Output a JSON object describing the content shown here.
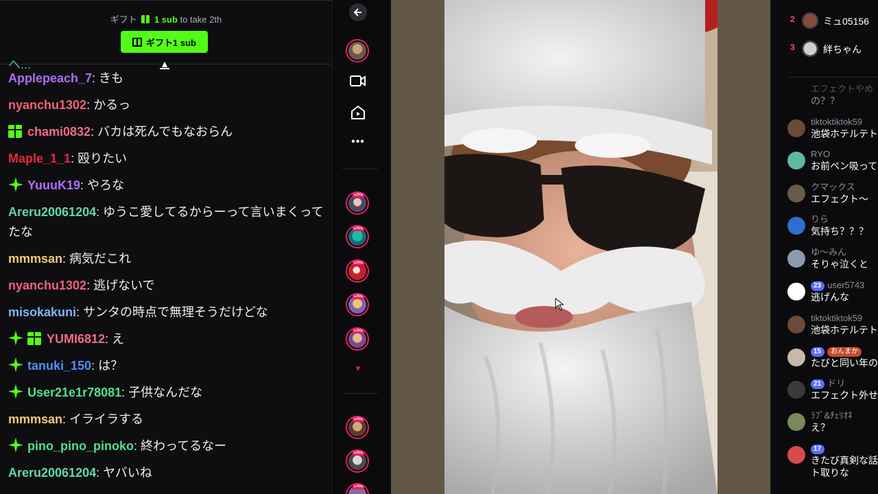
{
  "gift_bar": {
    "prompt_prefix": "ギフト",
    "prompt_highlight": "1 sub",
    "prompt_suffix": "to take 2th",
    "button_label": "ギフト1 sub",
    "accent_color": "#53fc18"
  },
  "left_chat": {
    "cut_off_text": "へ...",
    "messages": [
      {
        "user": "Applepeach_7",
        "color": "#b06cf8",
        "text": ": きも",
        "badges": []
      },
      {
        "user": "nyanchu1302",
        "color": "#f0607a",
        "text": ": かるっ",
        "badges": []
      },
      {
        "user": "chami0832",
        "color": "#ef6a86",
        "text": ": バカは死んでもなおらん",
        "badges": [
          "gift"
        ]
      },
      {
        "user": "Maple_1_1",
        "color": "#e8283c",
        "text": ": 殴りたい",
        "badges": []
      },
      {
        "user": "YuuuK19",
        "color": "#b06cf8",
        "text": ": やろな",
        "badges": [
          "sparkle"
        ]
      },
      {
        "user": "Areru20061204",
        "color": "#62d7b0",
        "text": ": ゆうこ愛してるからーって言いまくってたな",
        "badges": []
      },
      {
        "user": "mmmsan",
        "color": "#f6c87a",
        "text": ": 病気だこれ",
        "badges": []
      },
      {
        "user": "nyanchu1302",
        "color": "#f0607a",
        "text": ": 逃げないで",
        "badges": []
      },
      {
        "user": "misokakuni",
        "color": "#7fb4f5",
        "text": ": サンタの時点で無理そうだけどな",
        "badges": []
      },
      {
        "user": "YUMI6812",
        "color": "#ef6a86",
        "text": ": え",
        "badges": [
          "sparkle",
          "gift"
        ]
      },
      {
        "user": "tanuki_150",
        "color": "#4f8ef7",
        "text": ": は？",
        "badges": [
          "sparkle"
        ]
      },
      {
        "user": "User21e1r78081",
        "color": "#53e08d",
        "text": ": 子供なんだな",
        "badges": [
          "sparkle"
        ]
      },
      {
        "user": "mmmsan",
        "color": "#f6c87a",
        "text": ": イライラする",
        "badges": []
      },
      {
        "user": "pino_pino_pinoko",
        "color": "#53e08d",
        "text": ": 終わってるなー",
        "badges": [
          "sparkle"
        ]
      },
      {
        "user": "Areru20061204",
        "color": "#62d7b0",
        "text": ": ヤバいね",
        "badges": []
      }
    ]
  },
  "side_nav": {
    "back_icon": "arrow-left-icon",
    "live_label": "LIVE",
    "more_label": "•••",
    "chevron": "▾"
  },
  "right_chat": {
    "ranking": [
      {
        "rank": "2",
        "name": "ミュ05156"
      },
      {
        "rank": "3",
        "name": "絆ちゃん"
      }
    ],
    "messages": [
      {
        "name": "エフェクトやめ",
        "text": "の？？",
        "level": "",
        "extra": "",
        "text2": ""
      },
      {
        "name": "tiktoktiktok59",
        "text": "池袋ホテルテト",
        "level": "",
        "extra": "",
        "text2": ""
      },
      {
        "name": "RYO",
        "text": "お前ペン吸って",
        "level": "",
        "extra": "",
        "text2": ""
      },
      {
        "name": "クマックス",
        "text": "エフェクト〜",
        "level": "",
        "extra": "",
        "text2": ""
      },
      {
        "name": "りら",
        "text": "気持ち？？？",
        "level": "",
        "extra": "",
        "text2": ""
      },
      {
        "name": "ゆ〜みん",
        "text": "そりゃ泣くと",
        "level": "",
        "extra": "",
        "text2": ""
      },
      {
        "name": "user5743",
        "text": "逃げんな",
        "level": "23",
        "extra": "",
        "text2": ""
      },
      {
        "name": "tiktoktiktok59",
        "text": "池袋ホテルテト",
        "level": "",
        "extra": "",
        "text2": ""
      },
      {
        "name": "",
        "text": "たびと同い年の",
        "level": "15",
        "extra": "おんまか",
        "text2": ""
      },
      {
        "name": "ドリ",
        "text": "エフェクト外せ",
        "level": "21",
        "extra": "",
        "text2": ""
      },
      {
        "name": "ﾗﾌﾞ&ﾁｪﾘｵﾈ",
        "text": "え？",
        "level": "",
        "extra": "",
        "text2": ""
      },
      {
        "name": "",
        "text": "きたび真剣な話",
        "level": "17",
        "extra": "",
        "text2": "ト取りな"
      }
    ]
  }
}
